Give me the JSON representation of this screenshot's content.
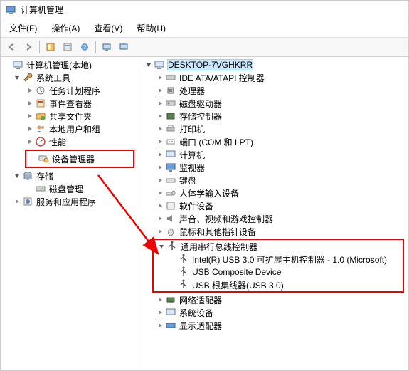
{
  "window": {
    "title": "计算机管理"
  },
  "menu": {
    "file": "文件(F)",
    "action": "操作(A)",
    "view": "查看(V)",
    "help": "帮助(H)"
  },
  "left_tree": {
    "root": "计算机管理(本地)",
    "system_tools": "系统工具",
    "task_scheduler": "任务计划程序",
    "event_viewer": "事件查看器",
    "shared_folders": "共享文件夹",
    "local_users": "本地用户和组",
    "performance": "性能",
    "device_manager": "设备管理器",
    "storage": "存储",
    "disk_management": "磁盘管理",
    "services_apps": "服务和应用程序"
  },
  "right_tree": {
    "computer": "DESKTOP-7VGHKRR",
    "ide": "IDE ATA/ATAPI 控制器",
    "processors": "处理器",
    "disk_drives": "磁盘驱动器",
    "storage_controllers": "存储控制器",
    "printers": "打印机",
    "ports": "端口 (COM 和 LPT)",
    "computer_cat": "计算机",
    "monitors": "监视器",
    "keyboards": "键盘",
    "hid": "人体学输入设备",
    "software": "软件设备",
    "audio": "声音、视频和游戏控制器",
    "mice": "鼠标和其他指针设备",
    "usb": "通用串行总线控制器",
    "usb_intel": "Intel(R) USB 3.0 可扩展主机控制器 - 1.0 (Microsoft)",
    "usb_composite": "USB Composite Device",
    "usb_root_hub": "USB 根集线器(USB 3.0)",
    "network": "网络适配器",
    "system_devices": "系统设备",
    "display": "显示适配器"
  }
}
